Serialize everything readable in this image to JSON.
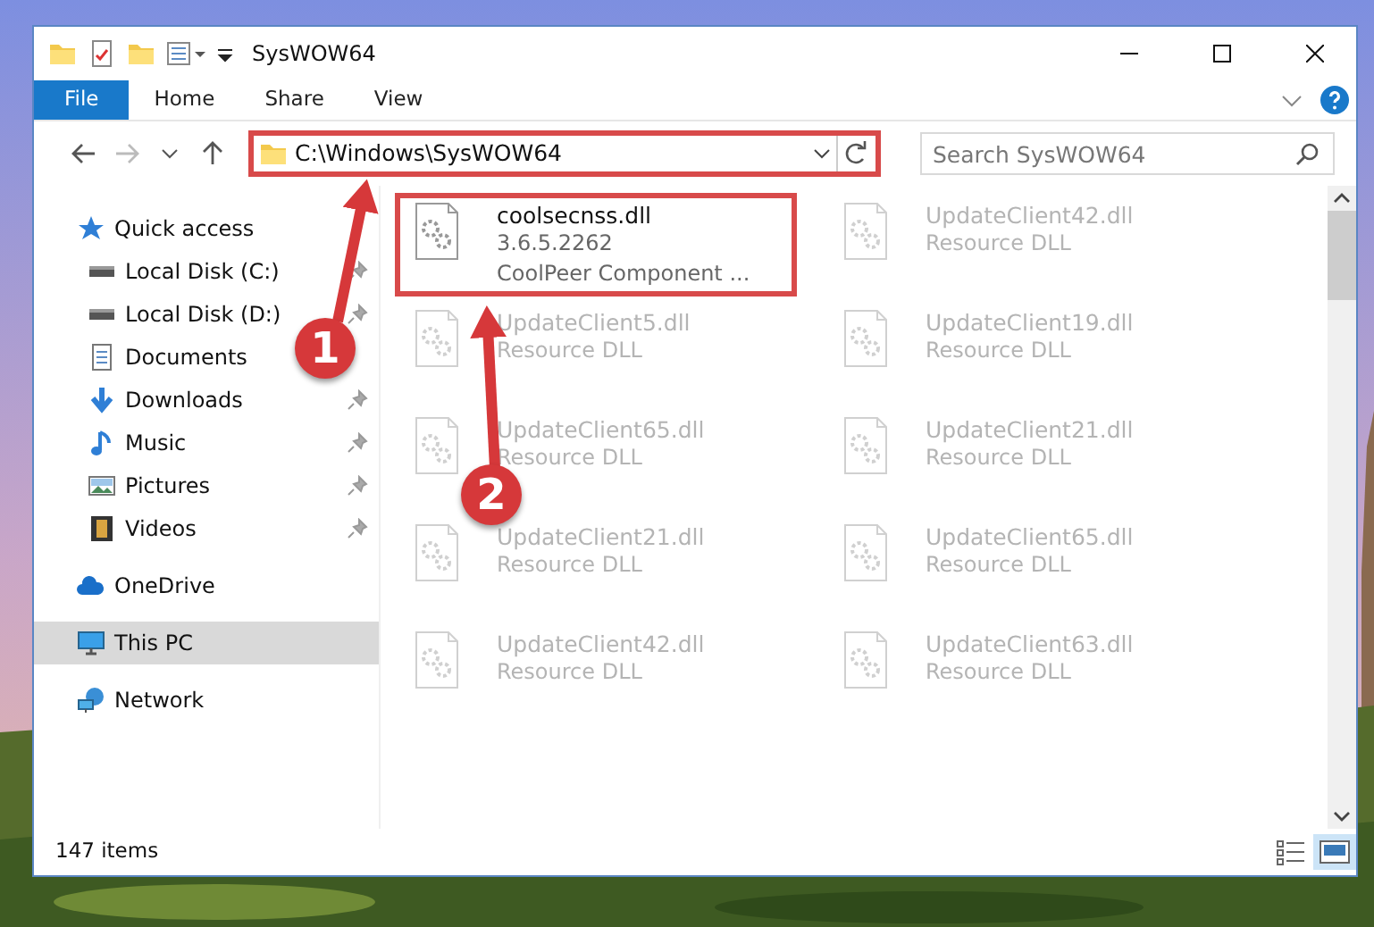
{
  "window": {
    "title": "SysWOW64"
  },
  "ribbon": {
    "tabs": [
      {
        "label": "File",
        "selected": true
      },
      {
        "label": "Home",
        "selected": false
      },
      {
        "label": "Share",
        "selected": false
      },
      {
        "label": "View",
        "selected": false
      }
    ]
  },
  "address_bar": {
    "path": "C:\\Windows\\SysWOW64",
    "highlighted": true,
    "callout": "1"
  },
  "search": {
    "placeholder": "Search SysWOW64"
  },
  "sidebar": {
    "items": [
      {
        "label": "Quick access",
        "kind": "star",
        "selected": false,
        "children": [
          {
            "label": "Local Disk (C:)",
            "kind": "disk",
            "selected": false,
            "pinned": true
          },
          {
            "label": "Local Disk (D:)",
            "kind": "disk",
            "selected": false,
            "pinned": true
          },
          {
            "label": "Documents",
            "kind": "document",
            "selected": false,
            "pinned": false
          },
          {
            "label": "Downloads",
            "kind": "download",
            "selected": false,
            "pinned": true
          },
          {
            "label": "Music",
            "kind": "music",
            "selected": false,
            "pinned": true
          },
          {
            "label": "Pictures",
            "kind": "pictures",
            "selected": false,
            "pinned": true
          },
          {
            "label": "Videos",
            "kind": "video",
            "selected": false,
            "pinned": true
          }
        ]
      },
      {
        "label": "OneDrive",
        "kind": "cloud",
        "selected": false
      },
      {
        "label": "This PC",
        "kind": "pc",
        "selected": true
      },
      {
        "label": "Network",
        "kind": "network",
        "selected": false
      }
    ]
  },
  "files": {
    "items": [
      {
        "name": "coolsecnss.dll",
        "details": [
          "3.6.5.2262",
          "CoolPeer Component ..."
        ],
        "highlighted": true,
        "dimmed": false,
        "callout": "2"
      },
      {
        "name": "UpdateClient42.dll",
        "details": [
          "Resource DLL"
        ],
        "highlighted": false,
        "dimmed": true
      },
      {
        "name": "UpdateClient5.dll",
        "details": [
          "Resource DLL"
        ],
        "highlighted": false,
        "dimmed": true
      },
      {
        "name": "UpdateClient19.dll",
        "details": [
          "Resource DLL"
        ],
        "highlighted": false,
        "dimmed": true
      },
      {
        "name": "UpdateClient65.dll",
        "details": [
          "Resource DLL"
        ],
        "highlighted": false,
        "dimmed": true
      },
      {
        "name": "UpdateClient21.dll",
        "details": [
          "Resource DLL"
        ],
        "highlighted": false,
        "dimmed": true
      },
      {
        "name": "UpdateClient21.dll",
        "details": [
          "Resource DLL"
        ],
        "highlighted": false,
        "dimmed": true
      },
      {
        "name": "UpdateClient65.dll",
        "details": [
          "Resource DLL"
        ],
        "highlighted": false,
        "dimmed": true
      },
      {
        "name": "UpdateClient42.dll",
        "details": [
          "Resource DLL"
        ],
        "highlighted": false,
        "dimmed": true
      },
      {
        "name": "UpdateClient63.dll",
        "details": [
          "Resource DLL"
        ],
        "highlighted": false,
        "dimmed": true
      }
    ]
  },
  "status_bar": {
    "count": "147 items",
    "views": [
      {
        "kind": "details",
        "selected": false
      },
      {
        "kind": "large-icons",
        "selected": true
      }
    ]
  }
}
